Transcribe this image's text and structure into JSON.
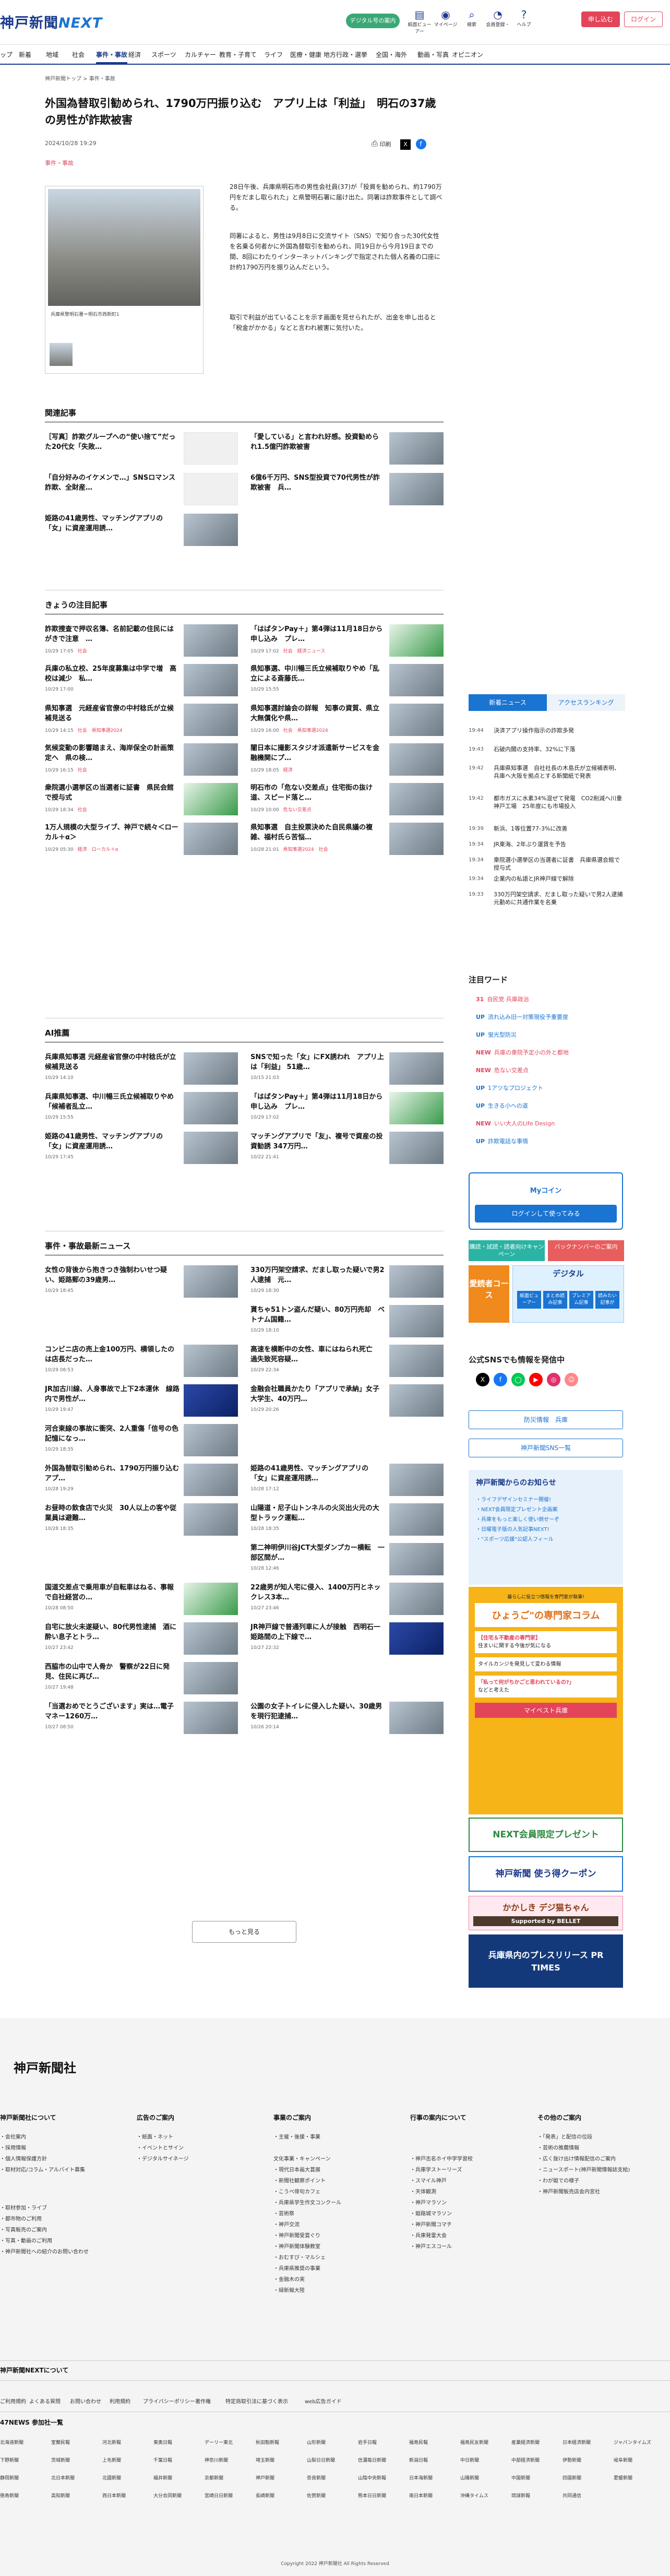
{
  "header": {
    "logo_main": "神戸新聞",
    "logo_next": "NEXT",
    "dsm_label": "デジタル号の案内",
    "icons": [
      {
        "label": "紙面ビューアー",
        "glyph": "▤"
      },
      {
        "label": "マイページ",
        "glyph": "◉"
      },
      {
        "label": "検索",
        "glyph": "⌕"
      },
      {
        "label": "会員登録・",
        "glyph": "◔"
      },
      {
        "label": "ヘルプ",
        "glyph": "?"
      }
    ],
    "signup": "申し込む",
    "login": "ログイン"
  },
  "nav": [
    "ップ",
    "新着",
    "地域",
    "社会",
    "事件・事故",
    "経済",
    "スポーツ",
    "カルチャー",
    "教育・子育て",
    "ライフ",
    "医療・健康",
    "地方行政・選挙",
    "全国・海外",
    "動画・写真",
    "オピニオン"
  ],
  "article": {
    "crumb": "神戸新聞トップ > 事件・事故",
    "title": "外国為替取引勧められ、1790万円振り込む　アプリ上は「利益」　明石の37歳の男性が詐欺被害",
    "date": "2024/10/28 19:29",
    "category": "事件・事故",
    "print": "印刷",
    "photo_caption": "兵庫県警明石署＝明石市西新町1",
    "paragraphs": [
      "28日午後、兵庫県明石市の男性会社員(37)が「投資を勧められ、約1790万円をだまし取られた」と県警明石署に届け出た。同署は詐欺事件として調べる。",
      "同署によると、男性は9月8日に交流サイト（SNS）で知り合った30代女性を名乗る何者かに外国為替取引を勧められ、同19日から今月19日までの間、8回にわたりインターネットバンキングで指定された個人名義の口座に計約1790万円を振り込んだという。",
      "取引で利益が出ていることを示す画面を見せられたが、出金を申し出ると「税金がかかる」などと言われ被害に気付いた。"
    ]
  },
  "related": {
    "heading": "関連記事",
    "items": [
      {
        "title": "［写真］詐欺グループへの“使い捨て”だった20代女「失敗…",
        "img": "w"
      },
      {
        "title": "「愛している」と言われ好感。投資勧められ1.5億円詐欺被害",
        "img": "n"
      },
      {
        "title": "「自分好みのイケメンで…」SNSロマンス詐欺、全財産…",
        "img": "w"
      },
      {
        "title": "6億6千万円、SNS型投資で70代男性が詐欺被害　兵…",
        "img": "n"
      },
      {
        "title": "姫路の41歳男性、マッチングアプリの「女」に資産運用誘…",
        "img": "n"
      }
    ]
  },
  "attention": {
    "heading": "きょうの注目記事",
    "items": [
      {
        "title": "詐欺捜査で押収名簿、名前記載の住民にはがきで注意　…",
        "date": "10/29 17:05",
        "cat": "社会",
        "img": "n"
      },
      {
        "title": "「はばタンPay＋」第4弾は11月18日から申し込み　プレ…",
        "date": "10/29 17:02",
        "cat": "社会　経済ニュース",
        "img": "g"
      },
      {
        "title": "兵庫の私立校、25年度募集は中学で増　高校は減少　私…",
        "date": "10/29 17:00",
        "cat": "",
        "img": "n"
      },
      {
        "title": "県知事選、中川暢三氏立候補取りやめ「乱立による斎藤氏…",
        "date": "10/29 15:55",
        "cat": "",
        "img": "n"
      },
      {
        "title": "県知事選　元経産省官僚の中村稔氏が立候補見送る",
        "date": "10/29 14:15",
        "cat": "社会　県知事選2024",
        "img": "n"
      },
      {
        "title": "県知事選討論会の詳報　知事の資質、県立大無償化や県…",
        "date": "10/29 16:00",
        "cat": "社会　県知事選2024",
        "img": "n"
      },
      {
        "title": "気候変動の影響踏まえ、海岸保全の計画策定へ　県の検…",
        "date": "10/29 16:15",
        "cat": "社会",
        "img": "n"
      },
      {
        "title": "闇日本に撮影スタジオ派遣新サービスを金融機関にプ…",
        "date": "10/29 18:05",
        "cat": "経済",
        "img": "n"
      },
      {
        "title": "衆院選小選挙区の当選者に証書　県民会館で授与式",
        "date": "10/29 18:34",
        "cat": "社会",
        "img": "g"
      },
      {
        "title": "明石市の「危ない交差点」住宅街の抜け道、スピード落と…",
        "date": "10/29 10:00",
        "cat": "危ない交差点",
        "img": "n"
      },
      {
        "title": "1万人規模の大型ライブ、神戸で続々＜ローカル＋α＞",
        "date": "10/29 05:30",
        "cat": "経済　ローカル＋α",
        "img": "n"
      },
      {
        "title": "県知事選　自主投票決めた自民県議の複雑、福村氏ら苦悩…",
        "date": "10/28 21:01",
        "cat": "県知事選2024　社会",
        "img": "n"
      }
    ]
  },
  "ai": {
    "heading": "AI推薦",
    "items": [
      {
        "title": "兵庫県知事選 元経産省官僚の中村稔氏が立候補見送る",
        "date": "10/29 14:10",
        "cat": "",
        "img": "n"
      },
      {
        "title": "SNSで知った「女」にFX誘われ　アプリ上は「利益」 51歳…",
        "date": "10/15 21:03",
        "cat": "",
        "img": "n"
      },
      {
        "title": "兵庫県知事選、中川暢三氏立候補取りやめ「候補者乱立…",
        "date": "10/29 15:55",
        "cat": "",
        "img": "n"
      },
      {
        "title": "「はばタンPay＋」第4弾は11月18日から申し込み　プレ…",
        "date": "10/29 17:02",
        "cat": "",
        "img": "g"
      },
      {
        "title": "姫路の41歳男性、マッチングアプリの「女」に資産運用誘…",
        "date": "10/29 17:45",
        "cat": "",
        "img": "n"
      },
      {
        "title": "マッチングアプリで「友」、複号で資産の投資勧誘 347万円…",
        "date": "10/22 21:41",
        "cat": "",
        "img": "n"
      }
    ]
  },
  "incidents": {
    "heading": "事件・事故最新ニュース",
    "items": [
      {
        "title": "女性の背後から抱きつき強制わいせつ疑い、姫路郵の39歳男…",
        "date": "10/29 18:45",
        "img": "n"
      },
      {
        "title": "330万円架空請求、だまし取った疑いで男2人逮捕　元…",
        "date": "10/29 18:30",
        "img": "n"
      },
      {
        "title": "",
        "date": "",
        "img": "none"
      },
      {
        "title": "貰ちゃ51トン盗んだ疑い、80万円売却　ベトナム国籍…",
        "date": "10/29 18:10",
        "img": "n"
      },
      {
        "title": "コンビニ店の売上金100万円、横領したのは店長だった…",
        "date": "10/29 08:53",
        "img": "n"
      },
      {
        "title": "高速を横断中の女性、車にはねられ死亡　過失致死容疑…",
        "date": "10/29 22:34",
        "img": "n"
      },
      {
        "title": "JR加古川線、人身事故で上下2本運休　線路内で男性が…",
        "date": "10/29 19:47",
        "img": "b"
      },
      {
        "title": "金融会社職員かたり「アプリで承納」女子大学生、40万円…",
        "date": "10/29 20:26",
        "img": "n"
      },
      {
        "title": "河合東線の事故に衝突、2人重傷「信号の色記憶になっ…",
        "date": "10/29 18:35",
        "img": "n"
      },
      {
        "title": "",
        "date": "",
        "img": "none"
      },
      {
        "title": "外国為替取引勧められ、1790万円振り込む　アプ…",
        "date": "10/28 19:29",
        "img": "n"
      },
      {
        "title": "姫路の41歳男性、マッチングアプリの「女」に資産運用誘…",
        "date": "10/28 17:12",
        "img": "n"
      },
      {
        "title": "お昼時の飲食店で火災　30人以上の客や従業員は避難…",
        "date": "10/28 18:35",
        "img": "n"
      },
      {
        "title": "山陽道・尼子山トンネルの火災出火元の大型トラック運転…",
        "date": "10/28 18:35",
        "img": "n"
      },
      {
        "title": "",
        "date": "",
        "img": "none"
      },
      {
        "title": "第二神明伊川谷JCT大型ダンプカー横転　一部区間が…",
        "date": "10/28 12:46",
        "img": "n"
      },
      {
        "title": "国道交差点で乗用車が自転車はねる、事報で自社経営の…",
        "date": "10/28 08:50",
        "img": "g"
      },
      {
        "title": "22歳男が知人宅に侵入、1400万円とネックレス3本…",
        "date": "10/27 23:46",
        "img": "n"
      },
      {
        "title": "自宅に放火未遂疑い、80代男性逮捕　酒に酔い息子とトラ…",
        "date": "10/27 23:42",
        "img": "n"
      },
      {
        "title": "JR神戸線で普通列車に人が接触　西明石一姫路間の上下線で…",
        "date": "10/27 22:32",
        "img": "b"
      },
      {
        "title": "西脇市の山中で人骨か　警察が22日に発見、住民に再び…",
        "date": "10/27 19:48",
        "img": "n"
      },
      {
        "title": "",
        "date": "",
        "img": "none"
      },
      {
        "title": "「当選おめでとうございます」実は…電子マネー1260万…",
        "date": "10/27 08:50",
        "img": "n"
      },
      {
        "title": "公園の女子トイレに侵入した疑い、30歳男を現行犯逮捕…",
        "date": "10/26 20:14",
        "img": "n"
      }
    ]
  },
  "more": "もっと見る",
  "sidebar": {
    "tab1": "新着ニュース",
    "tab2": "アクセスランキング",
    "news": [
      {
        "time": "19:44",
        "text": "決済アプリ操作指示の詐欺多発"
      },
      {
        "time": "19:43",
        "text": "石破内閣の支持率、32%に下落"
      },
      {
        "time": "19:42",
        "text": "兵庫県知事選　自社社長の木島氏が立候補表明、兵庫へ大阪を拠点とする新聞紙で発表"
      },
      {
        "time": "19:42",
        "text": "都市ガスに水素34%混ぜて発電　CO2削減へ川重神戸工場　25年度にも市場投入"
      },
      {
        "time": "19:39",
        "text": "新浜、1等位置77-3%に改善"
      },
      {
        "time": "19:34",
        "text": "JR東海、2年ぶり運賃を予告"
      },
      {
        "time": "19:34",
        "text": "衆院選小選挙区の当選者に証書　兵庫県選会館で授与式"
      },
      {
        "time": "19:34",
        "text": "企業内の私語とJR神戸線で解除"
      },
      {
        "time": "19:33",
        "text": "330万円架空請求、だまし取った疑いで男2人逮捕　元勤めに共通作業を名乗"
      }
    ],
    "kw_heading": "注目ワード",
    "keywords": [
      {
        "badge": "31",
        "cls": "nw",
        "text": "自民党 兵庫政治"
      },
      {
        "badge": "UP",
        "cls": "up",
        "text": "流れ込み旧一対策現役予重要度"
      },
      {
        "badge": "UP",
        "cls": "up",
        "text": "蛍光型防災"
      },
      {
        "badge": "NEW",
        "cls": "nw",
        "text": "兵庫の衆院予定小の外と都地"
      },
      {
        "badge": "NEW",
        "cls": "nw",
        "text": "危ない交差点"
      },
      {
        "badge": "UP",
        "cls": "up",
        "text": "1アツなプロジェクト"
      },
      {
        "badge": "UP",
        "cls": "up",
        "text": "生きる小への道"
      },
      {
        "badge": "NEW",
        "cls": "nw",
        "text": "いい大人のLife Design"
      },
      {
        "badge": "UP",
        "cls": "up",
        "text": "詐欺電話な事情"
      }
    ],
    "mycoin_title": "Myコイン",
    "mycoin_btn": "ログインして使ってみる",
    "banner_left": "購読・試読・読者向けキャンペーン",
    "banner_right": "バックナンバーのご案内",
    "course": "愛読者コース",
    "digital": "デジタル",
    "dig_items": [
      "紙面ビューアー",
      "まとめ読み記事",
      "プレミアム記事",
      "読みたい記事が"
    ],
    "sns_heading": "公式SNSでも情報を発信中",
    "sns_icons": [
      "X",
      "f",
      "◯",
      "▶",
      "◎",
      "☺"
    ],
    "btn1": "防災情報　兵庫",
    "btn2": "神戸新聞SNS一覧",
    "notice_heading": "神戸新聞からのお知らせ",
    "notices": [
      "・ライフデザインセミナー開催!",
      "・NEXT会員限定プレゼント企画案",
      "・兵庫をもっと楽しく使い倒せーぞ",
      "・日曜電子版の人気記事NEXT!",
      "・\"スポーツ応援\"公認人フィール"
    ],
    "col_title": "ひょうご\"の専門家コラム",
    "col_sub": "暮らしに役立つ情報を専門家が執筆!",
    "col_texts": [
      {
        "r": "【住宅＆不動産の専門家】",
        "t": "住まいに関する今後が気になる"
      },
      {
        "r": "",
        "t": "タイルカンジを発見して変わる情報"
      },
      {
        "r": "「私って何がちかごと思われているの?」",
        "t": "などと考えた"
      }
    ],
    "col_btn": "マイベスト兵庫",
    "present": "NEXT会員限定プレゼント",
    "coupon": "神戸新聞 使う得クーポン",
    "kakashi": "かかしき デジ猫ちゃん",
    "bellet": "Supported by BELLET",
    "prtimes": "兵庫県内のプレスリリース PR TIMES"
  },
  "footer": {
    "logo": "神戸新聞社",
    "cols": [
      {
        "h": "神戸新聞社について",
        "items": [
          "・会社案内",
          "・採用情報",
          "・個人情報保護方針",
          "・取材対応/コラム・アルバイト募集"
        ]
      },
      {
        "h": "広告のご案内",
        "items": [
          "・紙面・ネット",
          "・イベントとサイン",
          "・デジタルサイネージ"
        ]
      },
      {
        "h": "事業のご案内",
        "items": [
          "・主催・後援・事業",
          "",
          "文化事業・キャンペーン",
          "・現代日本画大賞展",
          "・新聞社観察ポイント",
          "・こうべ俳句カフェ",
          "・兵庫県学生作文コンクール",
          "・芸術祭",
          "・神戸交流",
          "・神戸新聞受賞ぐり",
          "・神戸新聞体験教室",
          "・おむすび・マルシェ",
          "・兵庫県推奨の事業",
          "・金融木の実",
          "・緑新報大陸"
        ]
      },
      {
        "h": "行事の案内について",
        "items": [
          "",
          "",
          "・神戸志名ホイ中学学習校",
          "・兵庫学ストーリーズ",
          "・スマイル神戸",
          "・天体観測",
          "・神戸マラソン",
          "・姫路城マラソン",
          "・神戸新聞コマチ",
          "・兵庫発雷大会",
          "・神戸エスコール"
        ]
      },
      {
        "h": "その他のご案内",
        "items": [
          "・「発表」と配信の位段",
          "・芸術の推薦情報",
          "・広く抜け出け情報配信のご案内",
          "・ニュースポート(神戸新聞情報誌支給)",
          "・わが姫での様子",
          "・神戸新聞販売店会内宮社"
        ]
      }
    ],
    "extra": [
      "・取材参加・ライブ",
      "・都市物のご利用",
      "・写真販売のご案内",
      "・写真・動画のご利用",
      "・神戸新聞社への紹介のお問い合わせ"
    ],
    "next_h": "神戸新聞NEXTについて",
    "bottom_links": [
      "ご利用規約",
      "よくある質問",
      "お問い合わせ",
      "利用規約",
      "プライバシーポリシー",
      "著作権",
      "特定商取引法に基づく表示",
      "web広告ガイド"
    ],
    "news47": "47NEWS 参加社一覧",
    "papers": [
      "北海道新聞",
      "室蘭民報",
      "河北新報",
      "東奥日報",
      "デーリー東北",
      "秋田魁新報",
      "山形新聞",
      "岩手日報",
      "福島民報",
      "福島民友新聞",
      "産業経済新聞",
      "日本経済新聞",
      "ジャパンタイムズ",
      "下野新聞",
      "茨城新聞",
      "上毛新聞",
      "千葉日報",
      "神奈川新聞",
      "埼玉新聞",
      "山梨日日新聞",
      "信濃毎日新聞",
      "新潟日報",
      "中日新聞",
      "中部経済新聞",
      "伊勢新聞",
      "岐阜新聞",
      "静岡新聞",
      "北日本新聞",
      "北國新聞",
      "福井新聞",
      "京都新聞",
      "神戸新聞",
      "奈良新聞",
      "山陰中央新報",
      "日本海新聞",
      "山陽新聞",
      "中国新聞",
      "四国新聞",
      "愛媛新聞",
      "徳島新聞",
      "高知新聞",
      "西日本新聞",
      "大分合同新聞",
      "宮崎日日新聞",
      "長崎新聞",
      "佐賀新聞",
      "熊本日日新聞",
      "南日本新聞",
      "沖縄タイムス",
      "琉球新報",
      "共同通信"
    ],
    "copy": "Copyright 2022 神戸新聞社 All Rights Reserved"
  }
}
